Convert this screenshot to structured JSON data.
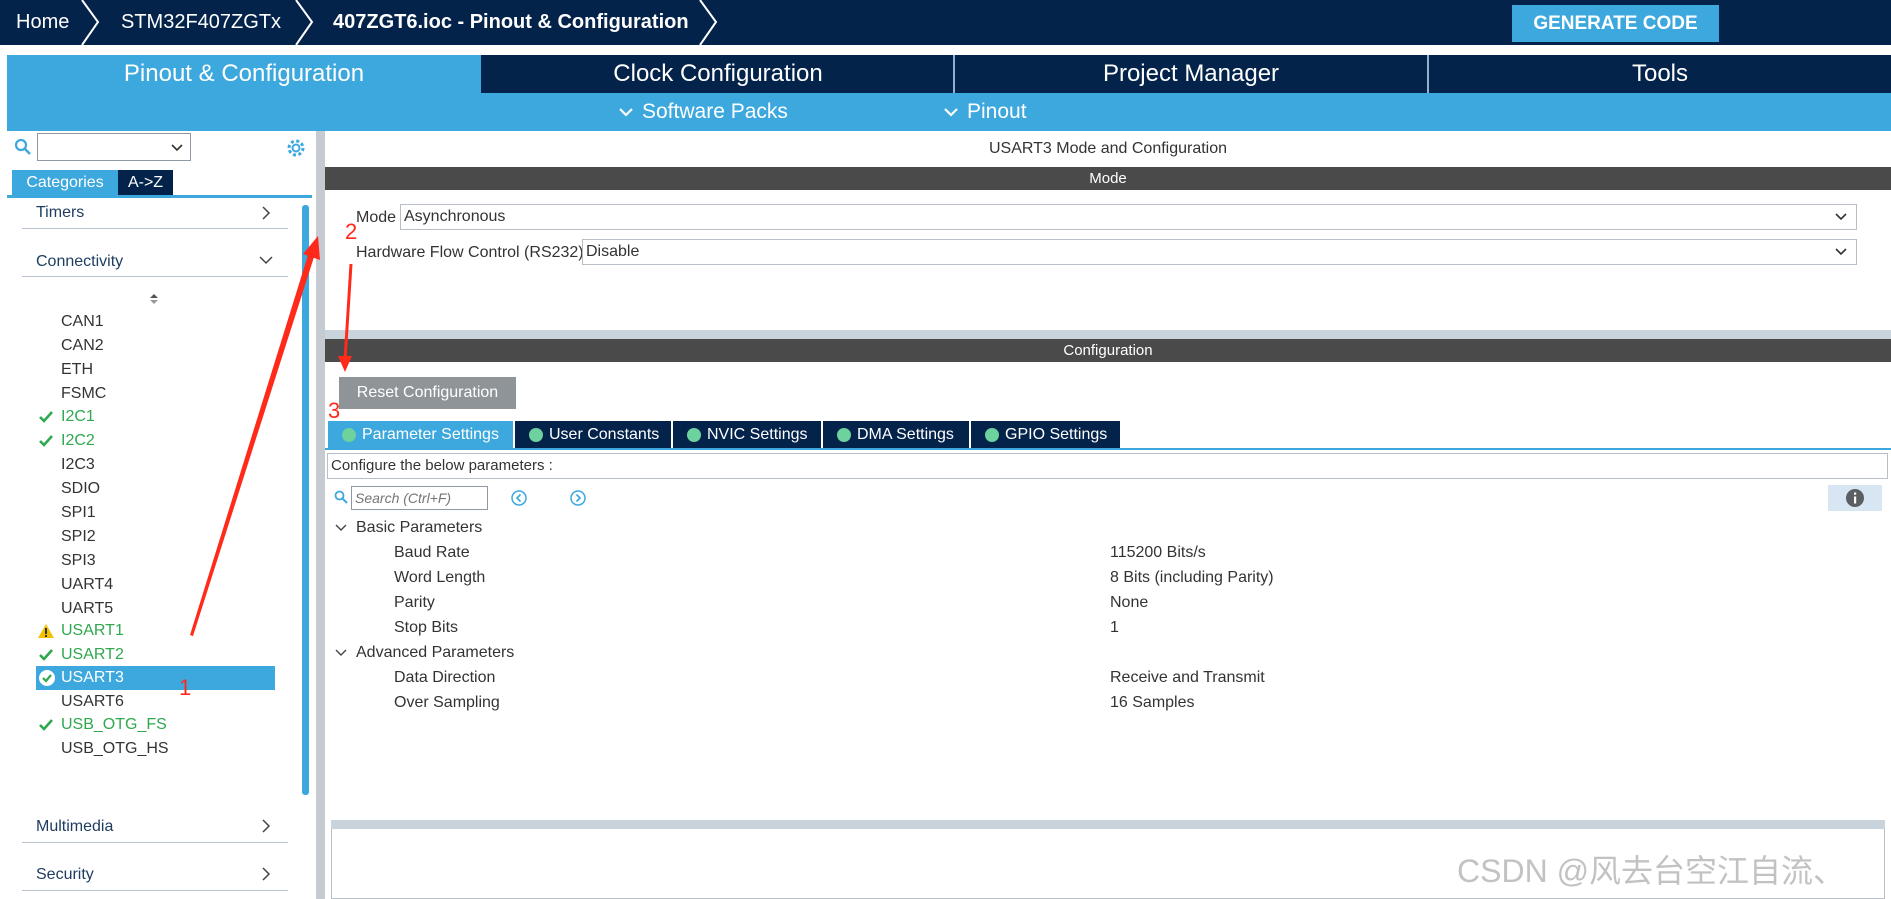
{
  "breadcrumb": {
    "home": "Home",
    "device": "STM32F407ZGTx",
    "file": "407ZGT6.ioc - Pinout & Configuration"
  },
  "generate_button": "GENERATE CODE",
  "main_tabs": [
    {
      "label": "Pinout & Configuration",
      "active": true
    },
    {
      "label": "Clock Configuration",
      "active": false
    },
    {
      "label": "Project Manager",
      "active": false
    },
    {
      "label": "Tools",
      "active": false
    }
  ],
  "sub_menus": [
    {
      "label": "Software Packs"
    },
    {
      "label": "Pinout"
    }
  ],
  "left": {
    "tab_categories": "Categories",
    "tab_az": "A->Z",
    "categories": {
      "timers": "Timers",
      "connectivity": "Connectivity",
      "multimedia": "Multimedia",
      "security": "Security"
    },
    "peripherals": [
      {
        "label": "CAN1",
        "state": "none"
      },
      {
        "label": "CAN2",
        "state": "none"
      },
      {
        "label": "ETH",
        "state": "none"
      },
      {
        "label": "FSMC",
        "state": "none"
      },
      {
        "label": "I2C1",
        "state": "ok"
      },
      {
        "label": "I2C2",
        "state": "ok"
      },
      {
        "label": "I2C3",
        "state": "none"
      },
      {
        "label": "SDIO",
        "state": "none"
      },
      {
        "label": "SPI1",
        "state": "none"
      },
      {
        "label": "SPI2",
        "state": "none"
      },
      {
        "label": "SPI3",
        "state": "none"
      },
      {
        "label": "UART4",
        "state": "none"
      },
      {
        "label": "UART5",
        "state": "none"
      },
      {
        "label": "USART1",
        "state": "warning"
      },
      {
        "label": "USART2",
        "state": "ok"
      },
      {
        "label": "USART3",
        "state": "selected"
      },
      {
        "label": "USART6",
        "state": "none"
      },
      {
        "label": "USB_OTG_FS",
        "state": "ok"
      },
      {
        "label": "USB_OTG_HS",
        "state": "none"
      }
    ]
  },
  "right": {
    "title": "USART3 Mode and Configuration",
    "mode_header": "Mode",
    "mode_label": "Mode",
    "mode_value": "Asynchronous",
    "flow_label": "Hardware Flow Control (RS232)",
    "flow_value": "Disable",
    "config_header": "Configuration",
    "reset_button": "Reset Configuration",
    "config_tabs": [
      {
        "label": "Parameter Settings",
        "active": true
      },
      {
        "label": "User Constants",
        "active": false
      },
      {
        "label": "NVIC Settings",
        "active": false
      },
      {
        "label": "DMA Settings",
        "active": false
      },
      {
        "label": "GPIO Settings",
        "active": false
      }
    ],
    "configure_text": "Configure the below parameters :",
    "search_placeholder": "Search (Ctrl+F)",
    "groups": [
      {
        "name": "Basic Parameters",
        "params": [
          {
            "name": "Baud Rate",
            "value": "115200 Bits/s"
          },
          {
            "name": "Word Length",
            "value": "8 Bits (including Parity)"
          },
          {
            "name": "Parity",
            "value": "None"
          },
          {
            "name": "Stop Bits",
            "value": "1"
          }
        ]
      },
      {
        "name": "Advanced Parameters",
        "params": [
          {
            "name": "Data Direction",
            "value": "Receive and Transmit"
          },
          {
            "name": "Over Sampling",
            "value": "16 Samples"
          }
        ]
      }
    ]
  },
  "annotations": {
    "n1": "1",
    "n2": "2",
    "n3": "3"
  },
  "watermark": "CSDN @风去台空江自流、",
  "colors": {
    "navy": "#03234b",
    "accent": "#3ca8de",
    "ok_green": "#2fa84f",
    "warning": "#f2c200",
    "annotation_red": "#ff2a1a"
  }
}
